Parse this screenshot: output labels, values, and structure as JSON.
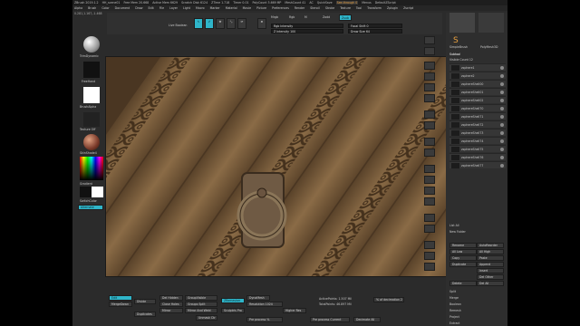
{
  "window": {
    "title_items": [
      "ZBrush 2019.1.2",
      "HH_scene01",
      "Free Mem 20.668",
      "Active Mem 6629",
      "Scratch Disk 6124",
      "ZTime 1.718",
      "Timer 0.01",
      "PolyCount 3.669 MP",
      "MeshCount 41"
    ],
    "right_items": [
      "AC",
      "QuickSave",
      "See-through 0",
      "Menus",
      "DefaultZScript"
    ]
  },
  "menu": {
    "items": [
      "Alpha",
      "Brush",
      "Color",
      "Document",
      "Draw",
      "Edit",
      "File",
      "Layer",
      "Light",
      "Macro",
      "Marker",
      "Material",
      "Movie",
      "Picture",
      "Preferences",
      "Render",
      "Stencil",
      "Stroke",
      "Texture",
      "Tool",
      "Transform",
      "Zplugin",
      "Zscript"
    ]
  },
  "coords": "0.281,1.167,-1.468",
  "toolbar": {
    "live_boolean": "Live Boolean",
    "mrgb": "Mrgb",
    "rgb": "Rgb",
    "m": "M",
    "zadd": "Zadd",
    "zsub": "Zsub",
    "z_intensity": "Z Intensity 100",
    "rgb_intensity": "Rgb Intensity",
    "zcut": "Zcut",
    "focal_shift": "Focal Shift 0",
    "draw_size": "Draw Size 64",
    "dynamic": "Dynamic",
    "active_points": "ActivePoints: 1.507 Mil",
    "total_points": "TotalPoints: 46.897 Mil",
    "spotlight": "Spotlight Projection"
  },
  "left": {
    "brush": "TrimDynamic",
    "stroke": "FreeHand",
    "alpha": "BrushAlpha",
    "texture": "Texture Off",
    "material": "SkinShade4",
    "gradient": "Gradient",
    "switch": "SwitchColor",
    "alternate": "Alternate"
  },
  "subtool": {
    "title": "Subtool",
    "visible_count": "Visible Count 12",
    "items": [
      "zsphere1",
      "zsphere2",
      "zsphereShell00",
      "zsphereShell01",
      "zsphereShell02",
      "zsphereShell70",
      "zsphereShell71",
      "zsphereShell72",
      "zsphereShell73",
      "zsphereShell74",
      "zsphereShell75",
      "zsphereShell76",
      "zsphereShell77"
    ],
    "list_all": "List All",
    "new_folder": "New Folder",
    "buttons": [
      "Rename",
      "AutoReorder",
      "All Low",
      "All High",
      "Copy",
      "Paste",
      "Duplicate",
      "Append",
      "Insert",
      "Del Other",
      "Delete",
      "Del All",
      "Split",
      "Merge",
      "Boolean",
      "Remesh",
      "Project",
      "Extract"
    ]
  },
  "tools": {
    "current": "SimpleBrush",
    "panel": "PolyMesh3D"
  },
  "bottom": {
    "edit": "Edit",
    "mergedown": "MergeDown",
    "divide": "Divide",
    "del_hidden": "Del Hidden",
    "close_holes": "Close Holes",
    "mirror": "Mirror",
    "duplicates": "Duplicates",
    "group_visible": "GroupVisible",
    "groups_split": "Groups Split",
    "mirror_and_weld": "Mirror And Weld",
    "unmask_ctr": "Unmask Ctr",
    "zremesher": "ZRemesher",
    "sculptris": "Sculptris Pro",
    "dynamesh": "DynaMesh",
    "resolution": "Resolution 1024",
    "pre_process": "Pre process %",
    "higher_res": "Higher Res",
    "pre_process_current": "Pre process Current",
    "decimate": "Decimate All",
    "of_decimation": "% of decimation 2"
  },
  "colors": {
    "accent": "#2fb5c9",
    "wood": "#7a5d3c"
  }
}
